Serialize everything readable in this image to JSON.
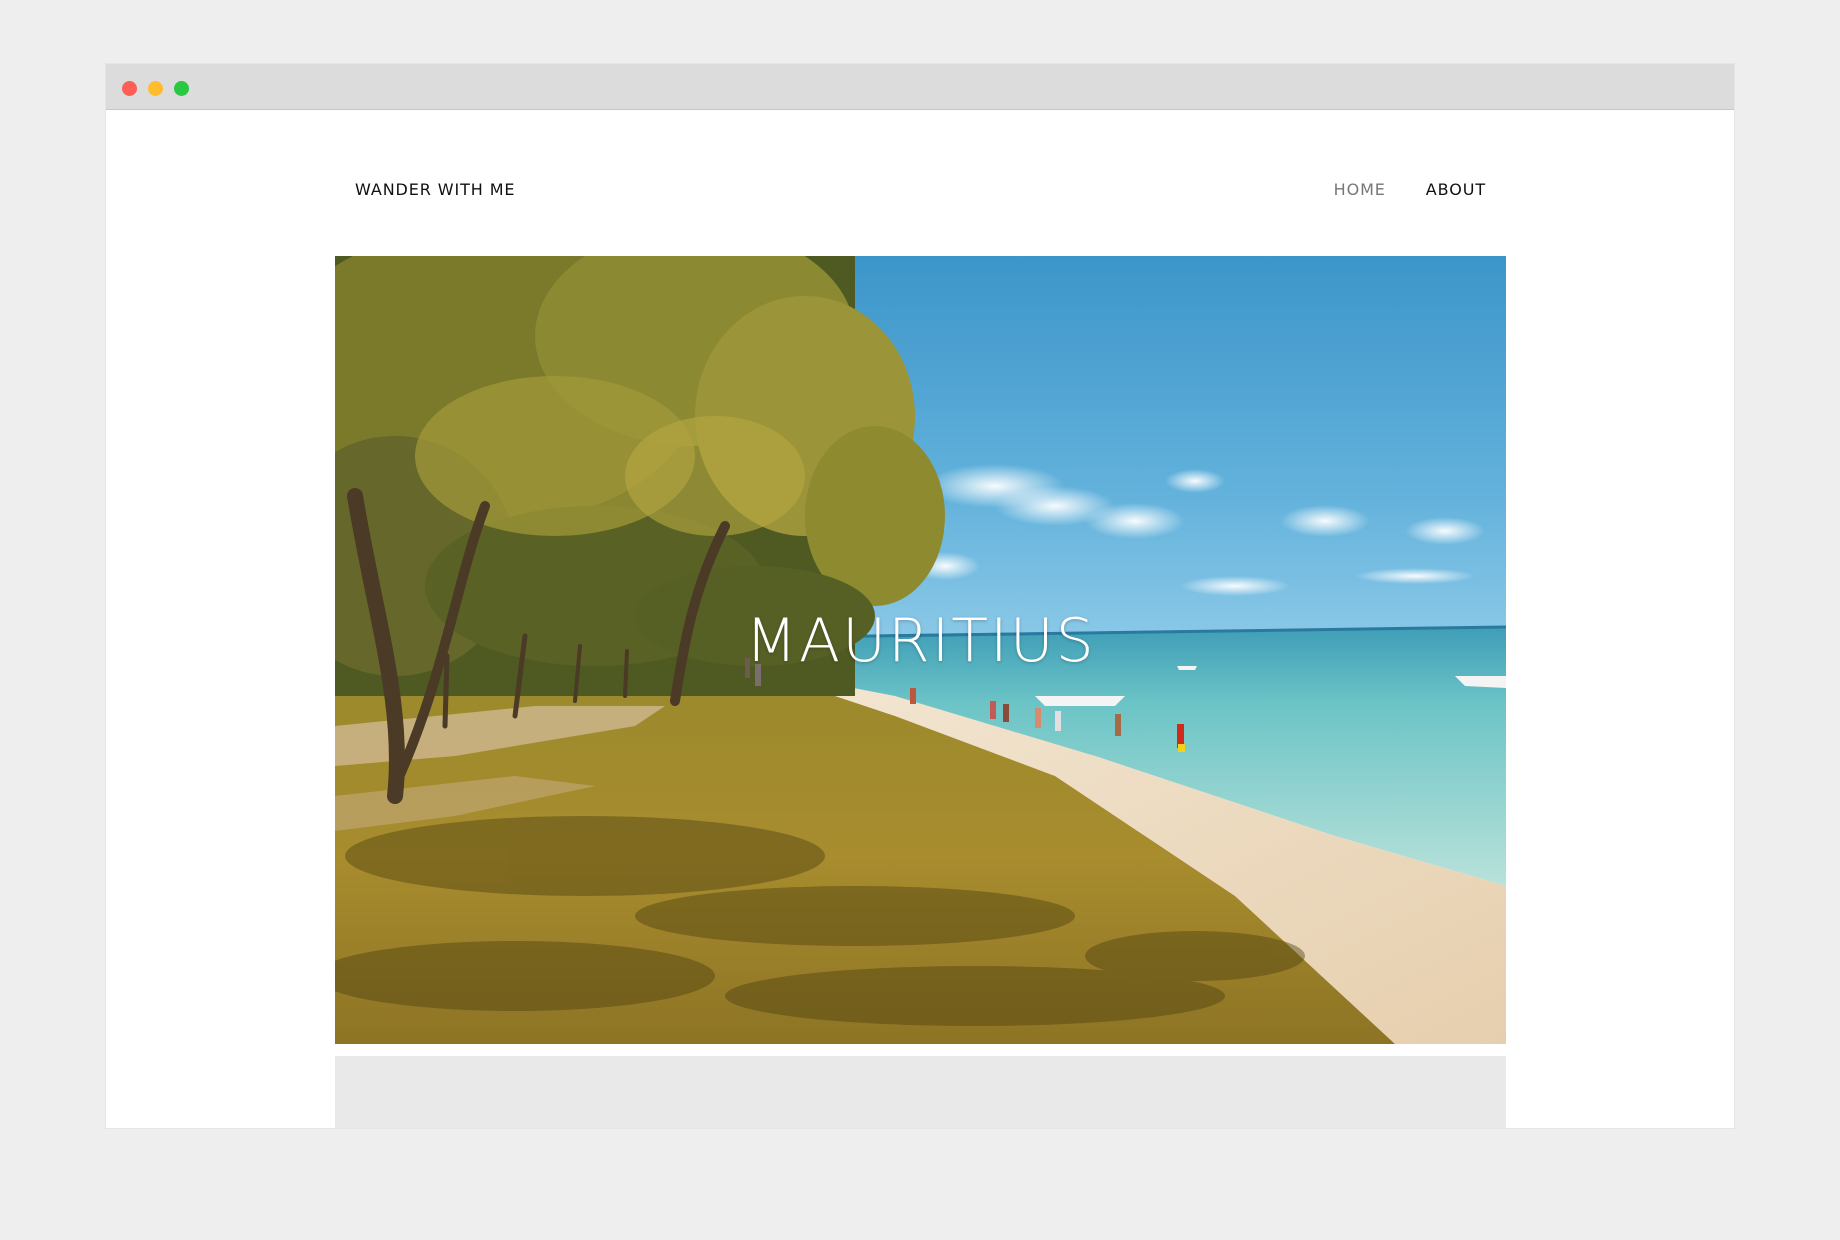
{
  "window": {
    "controls": [
      {
        "name": "close-dot",
        "color": "#fd5f57"
      },
      {
        "name": "minimize-dot",
        "color": "#febc2e"
      },
      {
        "name": "maximize-dot",
        "color": "#28c840"
      }
    ]
  },
  "header": {
    "logo": "WANDER WITH ME",
    "nav": [
      {
        "label": "HOME",
        "color": "#777777"
      },
      {
        "label": "ABOUT",
        "color": "#111111"
      }
    ]
  },
  "hero": {
    "title": "MAURITIUS"
  }
}
